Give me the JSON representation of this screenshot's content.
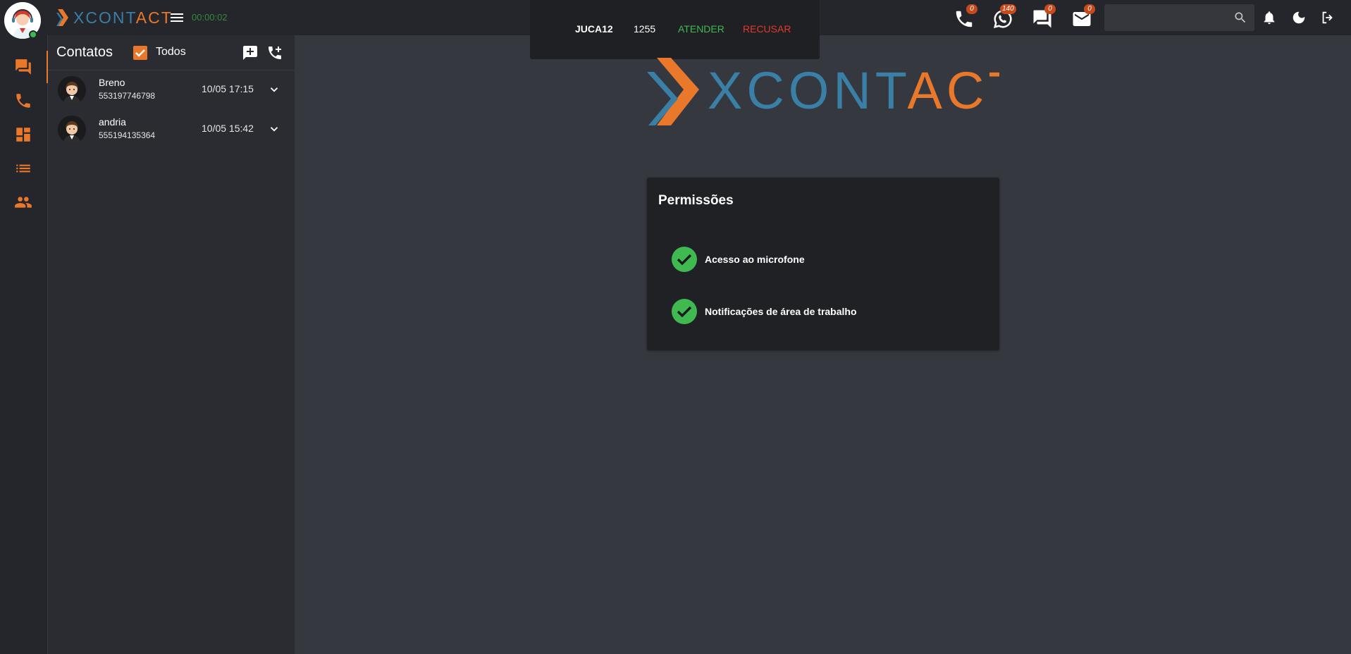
{
  "app": {
    "brand": {
      "part1": "XCONT",
      "part2": "ACT"
    },
    "timer": "00:00:02",
    "colors": {
      "accent": "#e9782b",
      "brand_blue": "#3a7fa6",
      "success": "#3fb950",
      "danger": "#e2392c"
    }
  },
  "call": {
    "name": "JUCA12",
    "extension": "1255",
    "answer_label": "ATENDER",
    "refuse_label": "RECUSAR"
  },
  "topbar": {
    "badges": {
      "phone": "0",
      "whatsapp": "140",
      "chat": "0",
      "email": "0"
    },
    "search": {
      "value": "",
      "placeholder": ""
    },
    "icons": [
      "phone-icon",
      "whatsapp-icon",
      "chat-icon",
      "email-icon",
      "search-icon",
      "bell-icon",
      "moon-icon",
      "logout-icon"
    ]
  },
  "rail": {
    "items": [
      "chat-icon",
      "phone-icon",
      "dashboard-icon",
      "list-icon",
      "people-icon"
    ]
  },
  "contacts": {
    "title": "Contatos",
    "filter_label": "Todos",
    "filter_checked": true,
    "rows": [
      {
        "name": "Breno",
        "phone": "553197746798",
        "time": "10/05 17:15"
      },
      {
        "name": "andria",
        "phone": "555194135364",
        "time": "10/05 15:42"
      }
    ]
  },
  "main": {
    "logo": {
      "part1": "XCONT",
      "part2": "ACT"
    },
    "permissions": {
      "title": "Permissões",
      "items": [
        {
          "label": "Acesso ao microfone",
          "granted": true
        },
        {
          "label": "Notificações de área de trabalho",
          "granted": true
        }
      ]
    }
  }
}
